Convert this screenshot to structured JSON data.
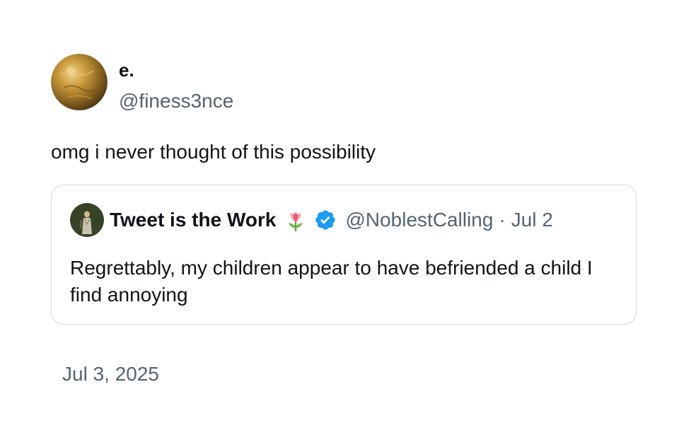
{
  "author": {
    "display_name": "e.",
    "handle": "@finess3nce",
    "avatar_icon": "gold-sphere-avatar"
  },
  "tweet": {
    "text": "omg i never thought of this possibility",
    "timestamp": "Jul 3, 2025"
  },
  "quoted_tweet": {
    "display_name": "Tweet is the Work",
    "emoji_icon": "tulip-icon",
    "verified_icon": "verified-badge-icon",
    "handle": "@NoblestCalling",
    "separator": "·",
    "date": "Jul 2",
    "text": "Regrettably, my children appear to have befriended a child I find annoying"
  },
  "colors": {
    "text_primary": "#0f1419",
    "text_secondary": "#536471",
    "border": "#cfd9de",
    "verified": "#1d9bf0"
  }
}
